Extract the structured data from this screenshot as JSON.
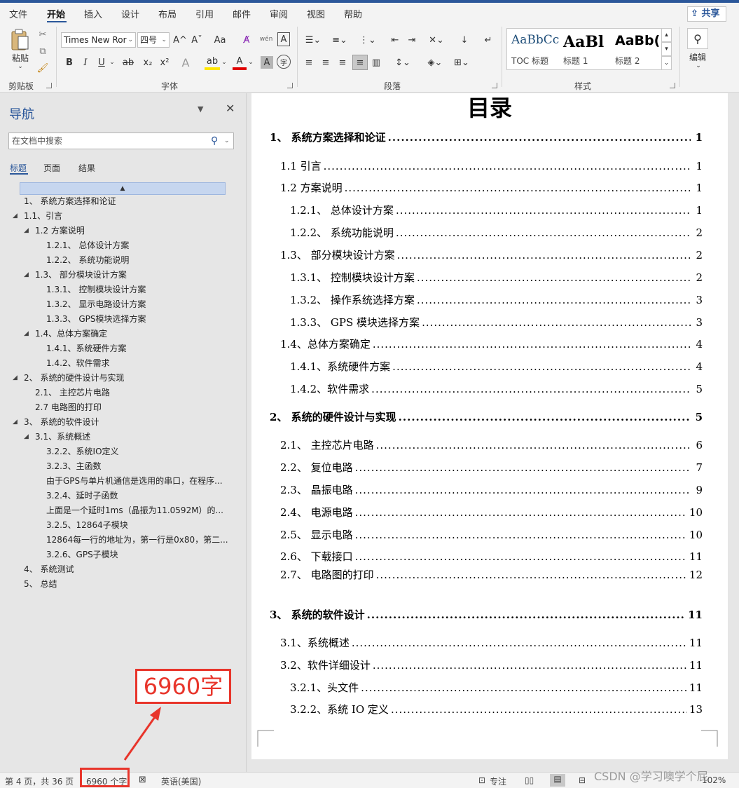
{
  "ribbon_tabs": [
    "文件",
    "开始",
    "插入",
    "设计",
    "布局",
    "引用",
    "邮件",
    "审阅",
    "视图",
    "帮助"
  ],
  "share_label": "共享",
  "clipboard": {
    "paste_label": "粘贴",
    "group_label": "剪贴板"
  },
  "font": {
    "name": "Times New Ror",
    "size": "四号",
    "group_label": "字体",
    "grow": "A^",
    "shrink": "Aˇ",
    "case": "Aa",
    "pinyin": "wén",
    "border_char": "A",
    "bold": "B",
    "italic": "I",
    "underline": "U",
    "strike": "ab",
    "sub": "x₂",
    "sup": "x²",
    "effects": "A",
    "highlight": "ab",
    "color": "A",
    "shading": "A",
    "enclose": "字"
  },
  "paragraph": {
    "group_label": "段落"
  },
  "styles": {
    "group_label": "样式",
    "items": [
      {
        "sample": "AaBbCc",
        "name": "TOC 标题"
      },
      {
        "sample": "AaBl",
        "name": "标题 1"
      },
      {
        "sample": "AaBb(",
        "name": "标题 2"
      }
    ]
  },
  "editing": {
    "label": "编辑"
  },
  "nav": {
    "title": "导航",
    "search_placeholder": "在文档中搜索",
    "tabs": [
      "标题",
      "页面",
      "结果"
    ],
    "headings": [
      {
        "text": "1、 系统方案选择和论证",
        "level": 1,
        "expand": false
      },
      {
        "text": "1.1、引言",
        "level": 1,
        "expand": true
      },
      {
        "text": "1.2 方案说明",
        "level": 2,
        "expand": true
      },
      {
        "text": "1.2.1、 总体设计方案",
        "level": 3,
        "expand": false
      },
      {
        "text": "1.2.2、 系统功能说明",
        "level": 3,
        "expand": false
      },
      {
        "text": "1.3、 部分模块设计方案",
        "level": 2,
        "expand": true
      },
      {
        "text": "1.3.1、 控制模块设计方案",
        "level": 3,
        "expand": false
      },
      {
        "text": "1.3.2、 显示电路设计方案",
        "level": 3,
        "expand": false
      },
      {
        "text": "1.3.3、 GPS模块选择方案",
        "level": 3,
        "expand": false
      },
      {
        "text": "1.4、总体方案确定",
        "level": 2,
        "expand": true
      },
      {
        "text": "1.4.1、系统硬件方案",
        "level": 3,
        "expand": false
      },
      {
        "text": "1.4.2、软件需求",
        "level": 3,
        "expand": false
      },
      {
        "text": "2、 系统的硬件设计与实现",
        "level": 1,
        "expand": true
      },
      {
        "text": "2.1、 主控芯片电路",
        "level": 2,
        "expand": false
      },
      {
        "text": "2.7 电路图的打印",
        "level": 2,
        "expand": false
      },
      {
        "text": "3、 系统的软件设计",
        "level": 1,
        "expand": true
      },
      {
        "text": "3.1、系统概述",
        "level": 2,
        "expand": true
      },
      {
        "text": "3.2.2、系统IO定义",
        "level": 3,
        "expand": false
      },
      {
        "text": "3.2.3、主函数",
        "level": 3,
        "expand": false
      },
      {
        "text": "由于GPS与单片机通信是选用的串口，在程序...",
        "level": 3,
        "expand": false
      },
      {
        "text": "3.2.4、延时子函数",
        "level": 3,
        "expand": false
      },
      {
        "text": "上面是一个延时1ms（晶振为11.0592M）的...",
        "level": 3,
        "expand": false
      },
      {
        "text": "3.2.5、12864子模块",
        "level": 3,
        "expand": false
      },
      {
        "text": "12864每一行的地址为，第一行是0x80，第二...",
        "level": 3,
        "expand": false
      },
      {
        "text": "3.2.6、GPS子模块",
        "level": 3,
        "expand": false
      },
      {
        "text": "4、 系统测试",
        "level": 1,
        "expand": false
      },
      {
        "text": "5、 总结",
        "level": 1,
        "expand": false
      }
    ]
  },
  "document": {
    "title": "目录",
    "toc": [
      {
        "text": "1、  系统方案选择和论证",
        "page": "1",
        "level": 1
      },
      {
        "text": "1.1 引言",
        "page": "1",
        "level": 2
      },
      {
        "text": "1.2 方案说明",
        "page": "1",
        "level": 2
      },
      {
        "text": "1.2.1、  总体设计方案",
        "page": "1",
        "level": 3
      },
      {
        "text": "1.2.2、  系统功能说明",
        "page": "2",
        "level": 3
      },
      {
        "text": "1.3、  部分模块设计方案",
        "page": "2",
        "level": 2
      },
      {
        "text": "1.3.1、  控制模块设计方案",
        "page": "2",
        "level": 3
      },
      {
        "text": "1.3.2、  操作系统选择方案",
        "page": "3",
        "level": 3
      },
      {
        "text": "1.3.3、  GPS 模块选择方案",
        "page": "3",
        "level": 3
      },
      {
        "text": "1.4、总体方案确定",
        "page": "4",
        "level": 2
      },
      {
        "text": "1.4.1、系统硬件方案",
        "page": "4",
        "level": 3
      },
      {
        "text": "1.4.2、软件需求",
        "page": "5",
        "level": 3
      },
      {
        "text": "2、  系统的硬件设计与实现",
        "page": "5",
        "level": 1
      },
      {
        "text": "2.1、  主控芯片电路",
        "page": "6",
        "level": 2
      },
      {
        "text": "2.2、  复位电路",
        "page": "7",
        "level": 2
      },
      {
        "text": "2.3、  晶振电路",
        "page": "9",
        "level": 2
      },
      {
        "text": "2.4、  电源电路",
        "page": "10",
        "level": 2
      },
      {
        "text": "2.5、  显示电路",
        "page": "10",
        "level": 2
      },
      {
        "text": "2.6、  下载接口",
        "page": "11",
        "level": 2
      },
      {
        "text": "2.7、  电路图的打印",
        "page": "12",
        "level": 2
      },
      {
        "text": "3、  系统的软件设计",
        "page": "11",
        "level": 1
      },
      {
        "text": "3.1、系统概述",
        "page": "11",
        "level": 2
      },
      {
        "text": "3.2、软件详细设计",
        "page": "11",
        "level": 2
      },
      {
        "text": "3.2.1、头文件",
        "page": "11",
        "level": 3
      },
      {
        "text": "3.2.2、系统 IO 定义",
        "page": "13",
        "level": 3
      }
    ]
  },
  "status": {
    "page": "第 4 页，共 36 页",
    "words": "6960 个字",
    "language": "英语(美国)",
    "focus": "专注",
    "zoom": "102%"
  },
  "annotation": {
    "callout": "6960字",
    "color": "#e8352b"
  },
  "watermark": "CSDN @学习噢学个屁",
  "colors": {
    "accent": "#2b579a",
    "annotation": "#e8352b"
  }
}
